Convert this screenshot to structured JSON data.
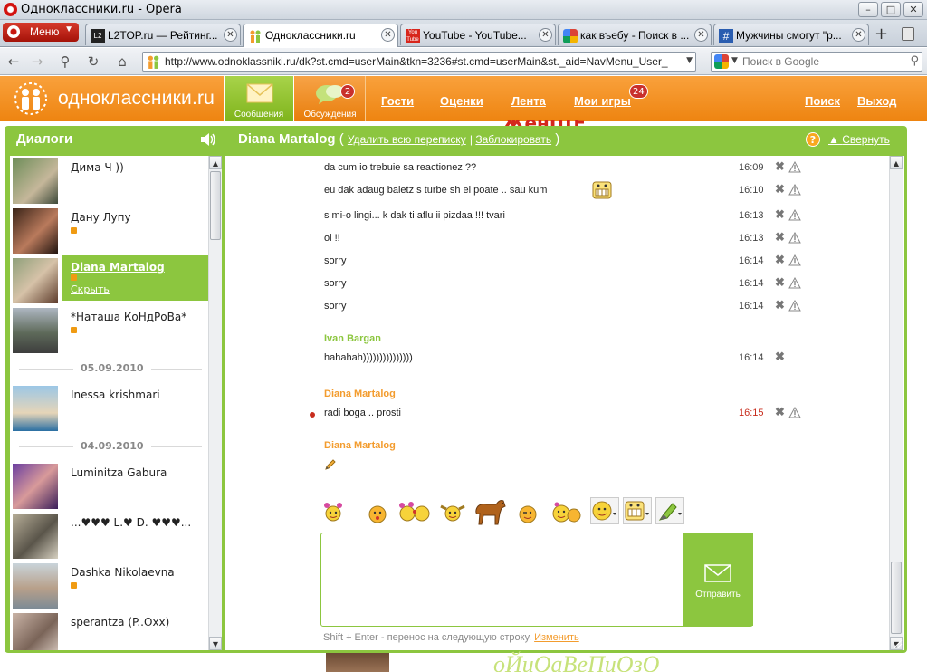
{
  "window": {
    "title": "Одноклассники.ru - Opera"
  },
  "browser": {
    "menu_label": "Меню",
    "tabs": [
      {
        "label": "L2TOP.ru — Рейтинг...",
        "favicon": "l2top-icon",
        "favicon_text": "L2 TOP"
      },
      {
        "label": "Одноклассники.ru",
        "favicon": "odnoklassniki-icon",
        "active": true
      },
      {
        "label": "YouTube - YouTube...",
        "favicon": "youtube-icon",
        "favicon_text": "You Tube"
      },
      {
        "label": "как въебу - Поиск в ...",
        "favicon": "google-icon"
      },
      {
        "label": "Мужчины смогут \"р...",
        "favicon": "hash-icon",
        "favicon_text": "#"
      }
    ],
    "url": "http://www.odnoklassniki.ru/dk?st.cmd=userMain&tkn=3236#st.cmd=userMain&st._aid=NavMenu_User_",
    "search_placeholder": "Поиск в Google"
  },
  "site": {
    "logo_text": "одноклассники.ru",
    "tiles": {
      "messages": "Сообщения",
      "discussions": "Обсуждения",
      "discussions_badge": "2"
    },
    "nav": {
      "guests": "Гости",
      "ratings": "Оценки",
      "feed": "Лента",
      "games": "Мои игры",
      "games_badge": "24",
      "search": "Поиск",
      "logout": "Выход"
    },
    "bg_text": "оЙиОаВеПиОзО",
    "bg_text_top": "ЖенЩЕ"
  },
  "dialogs": {
    "title": "Диалоги",
    "contacts": [
      {
        "name": "Дима Ч ))",
        "online": false
      },
      {
        "name": "Дану Лупу",
        "online": true
      },
      {
        "name": "Diana Martalog",
        "online": true,
        "selected": true,
        "hide_label": "Скрыть"
      },
      {
        "name": "*Наташа КоНдРоВа*",
        "online": true
      }
    ],
    "date_1": "05.09.2010",
    "contacts_2": [
      {
        "name": "Inessa krishmari",
        "online": false
      }
    ],
    "date_2": "04.09.2010",
    "contacts_3": [
      {
        "name": "Luminitza Gabura",
        "online": false
      },
      {
        "name": "...♥♥♥ L.♥ D. ♥♥♥...",
        "online": false
      },
      {
        "name": "Dashka Nikolaevna",
        "online": true
      },
      {
        "name": "sperantza (P..Oxx)",
        "online": false
      }
    ]
  },
  "chat": {
    "partner": "Diana Martalog",
    "delete_all": "Удалить всю переписку",
    "block": "Заблокировать",
    "collapse": "Свернуть",
    "messages": [
      {
        "text": "da cum io trebuie sa reactionez ??",
        "time": "16:09"
      },
      {
        "text": "eu dak adaug baietz s turbe sh el poate .. sau kum",
        "time": "16:10",
        "emoticon": "grin-smiley"
      },
      {
        "text": "s mi-o lingi... k dak ti aflu ii pizdaa !!! tvari",
        "time": "16:13"
      },
      {
        "text": "oi !!",
        "time": "16:13"
      },
      {
        "text": "sorry",
        "time": "16:14"
      },
      {
        "text": "sorry",
        "time": "16:14"
      },
      {
        "text": "sorry",
        "time": "16:14"
      }
    ],
    "sender_2": "Ivan Bargan",
    "messages_2": [
      {
        "text": "hahahah)))))))))))))))",
        "time": "16:14"
      }
    ],
    "sender_3": "Diana Martalog",
    "messages_3": [
      {
        "text": "radi boga .. prosti",
        "time": "16:15",
        "unread": true
      }
    ],
    "sender_4": "Diana Martalog",
    "send_label": "Отправить",
    "hint": "Shift + Enter - перенос на следующую строку.",
    "hint_link": "Изменить"
  },
  "colors": {
    "ok_orange": "#ee8410",
    "ok_green": "#8cc63f",
    "unread_red": "#c82d1d"
  }
}
